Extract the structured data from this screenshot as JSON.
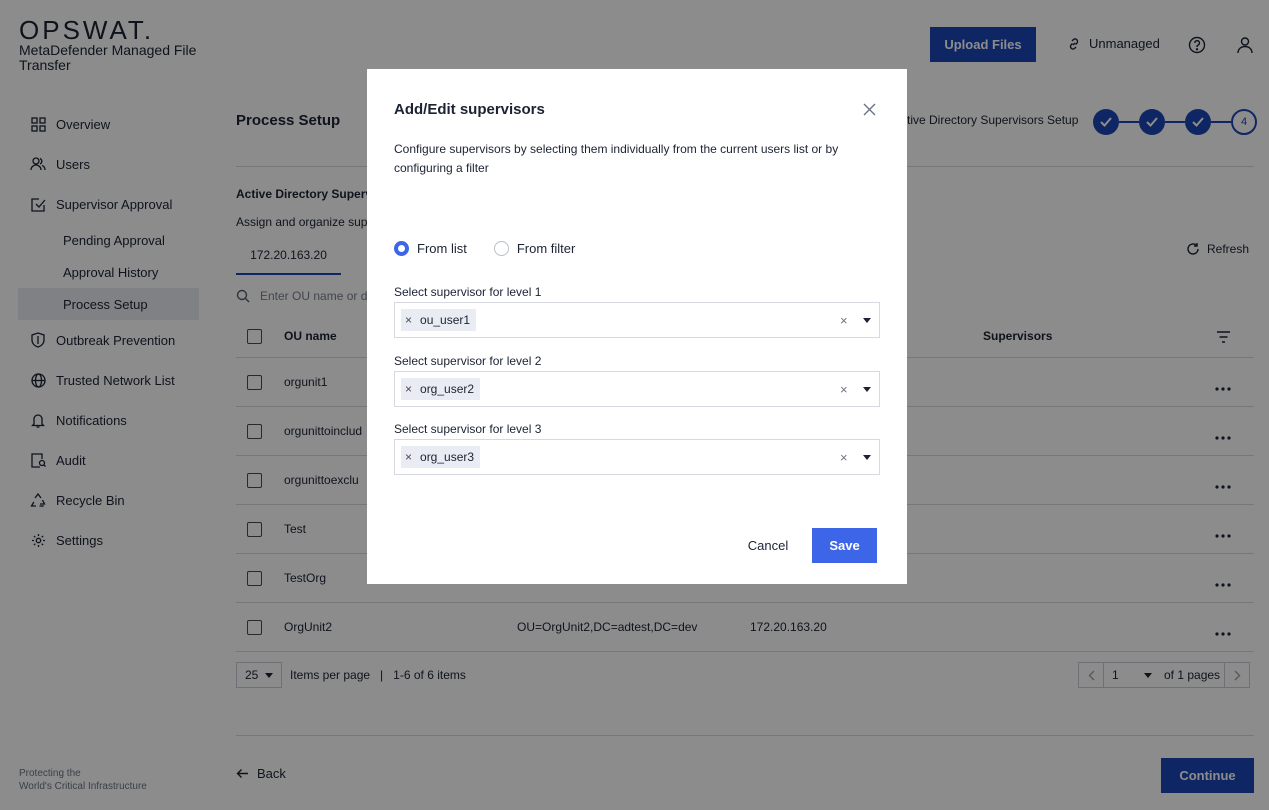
{
  "brand": {
    "logo": "OPSWAT.",
    "product": "MetaDefender Managed File Transfer",
    "footer_line1": "Protecting the",
    "footer_line2": "World's Critical Infrastructure"
  },
  "nav": {
    "overview": "Overview",
    "users": "Users",
    "supervisor_approval": "Supervisor Approval",
    "pending_approval": "Pending Approval",
    "approval_history": "Approval History",
    "process_setup": "Process Setup",
    "outbreak_prevention": "Outbreak Prevention",
    "trusted_network_list": "Trusted Network List",
    "notifications": "Notifications",
    "audit": "Audit",
    "recycle_bin": "Recycle Bin",
    "settings": "Settings"
  },
  "topbar": {
    "upload_label": "Upload Files",
    "unmanaged_label": "Unmanaged"
  },
  "main": {
    "title": "Process Setup",
    "steps_label": "Active Directory Supervisors Setup",
    "step_4": "4",
    "section_title": "Active Directory Supervi",
    "section_desc": "Assign and organize sup",
    "ip_tab": "172.20.163.20",
    "refresh_label": "Refresh",
    "search_placeholder": "Enter OU name or di",
    "columns": {
      "ou_name": "OU name",
      "supervisors": "Supervisors"
    },
    "rows": [
      {
        "name": "orgunit1",
        "dn": "",
        "ip": ""
      },
      {
        "name": "orgunittoinclud",
        "dn": "",
        "ip": ""
      },
      {
        "name": "orgunittoexclu",
        "dn": "",
        "ip": ""
      },
      {
        "name": "Test",
        "dn": "",
        "ip": ""
      },
      {
        "name": "TestOrg",
        "dn": "",
        "ip": ""
      },
      {
        "name": "OrgUnit2",
        "dn": "OU=OrgUnit2,DC=adtest,DC=dev",
        "ip": "172.20.163.20"
      }
    ],
    "pagination": {
      "per_page": "25",
      "per_page_label": "Items per page",
      "sep": "|",
      "range": "1-6 of 6 items",
      "page": "1",
      "of_pages": "of 1 pages"
    },
    "back_label": "Back",
    "continue_label": "Continue"
  },
  "modal": {
    "title": "Add/Edit supervisors",
    "description": "Configure supervisors by selecting them individually from the current users list or by configuring a filter",
    "radio_list": "From list",
    "radio_filter": "From filter",
    "levels": [
      {
        "label": "Select supervisor for level 1",
        "value": "ou_user1"
      },
      {
        "label": "Select supervisor for level 2",
        "value": "org_user2"
      },
      {
        "label": "Select supervisor for level 3",
        "value": "org_user3"
      }
    ],
    "cancel_label": "Cancel",
    "save_label": "Save"
  },
  "colors": {
    "primary": "#1d45b8",
    "accent": "#3d65e8",
    "overlay": "#000000"
  }
}
